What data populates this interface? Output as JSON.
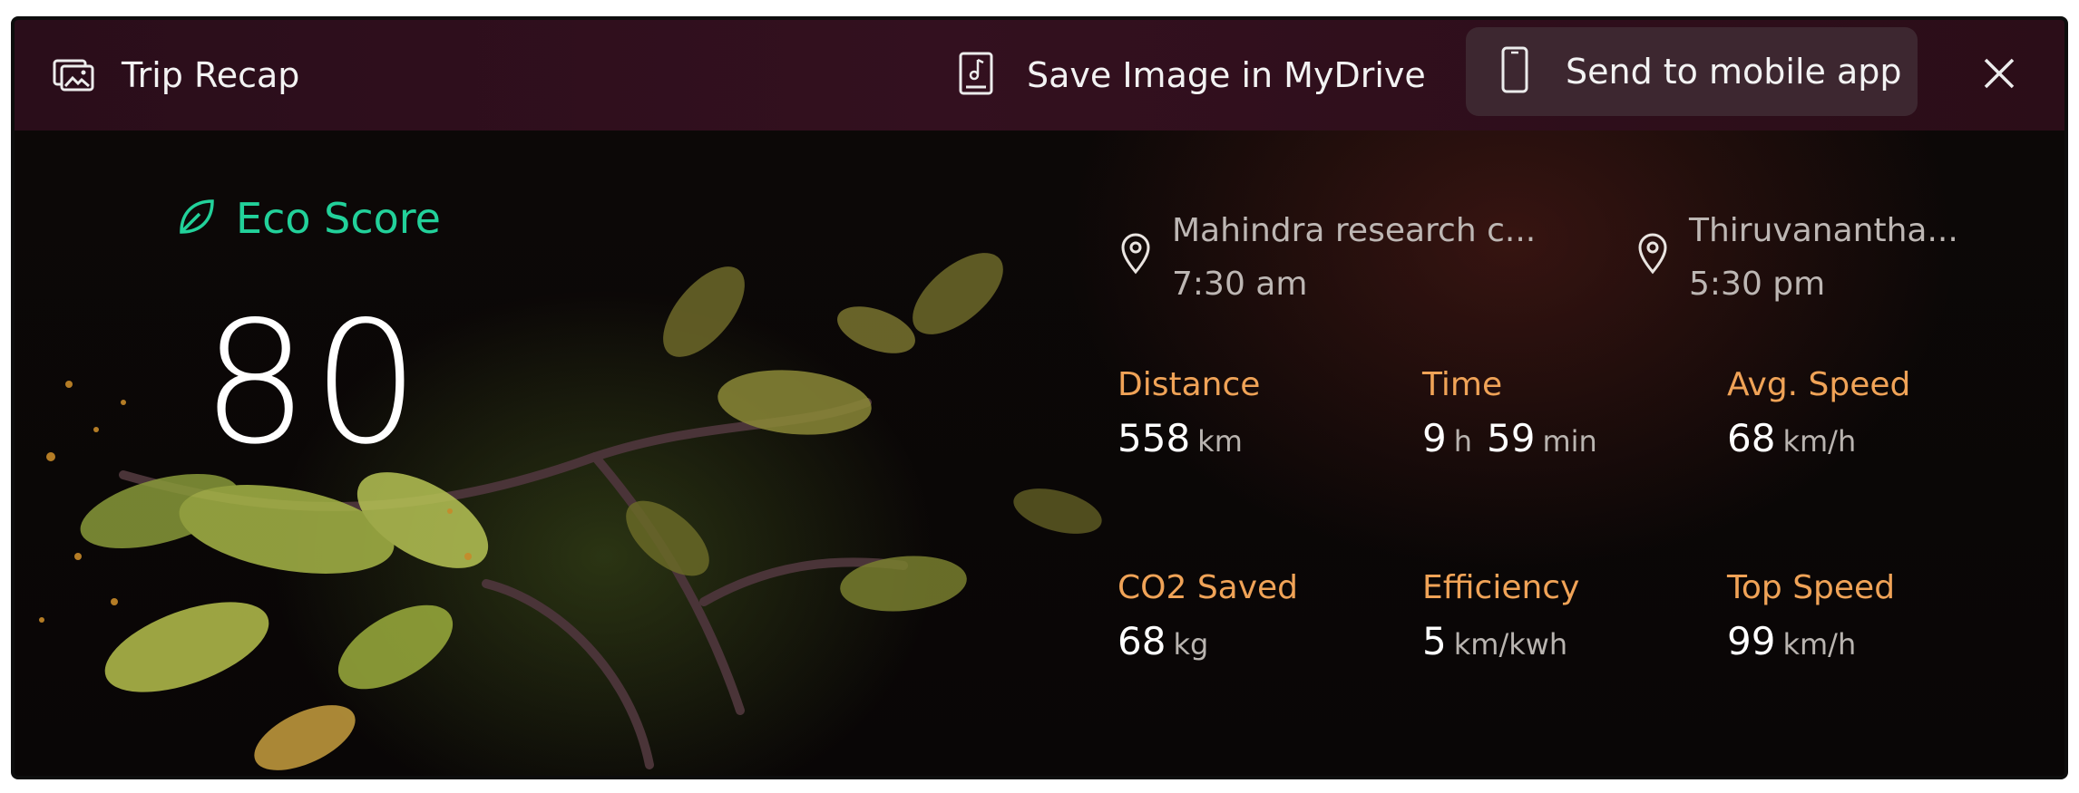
{
  "header": {
    "title": "Trip Recap",
    "save_label": "Save Image in MyDrive",
    "send_label": "Send to mobile app"
  },
  "eco": {
    "label": "Eco Score",
    "score": "80"
  },
  "route": {
    "start": {
      "name": "Mahindra research c...",
      "time": "7:30 am"
    },
    "end": {
      "name": "Thiruvanantha...",
      "time": "5:30 pm"
    }
  },
  "stats": {
    "distance": {
      "label": "Distance",
      "value": "558",
      "unit": "km"
    },
    "time": {
      "label": "Time",
      "hours": "9",
      "hours_unit": "h",
      "minutes": "59",
      "minutes_unit": "min"
    },
    "avg_speed": {
      "label": "Avg. Speed",
      "value": "68",
      "unit": "km/h"
    },
    "co2_saved": {
      "label": "CO2 Saved",
      "value": "68",
      "unit": "kg"
    },
    "efficiency": {
      "label": "Efficiency",
      "value": "5",
      "unit": "km/kwh"
    },
    "top_speed": {
      "label": "Top Speed",
      "value": "99",
      "unit": "km/h"
    }
  },
  "colors": {
    "header_bg": "#2a0d1a",
    "eco_green": "#22d19a",
    "stat_label_orange": "#f0a357",
    "send_button_bg": "#3d2730"
  },
  "icons": {
    "title": "gallery-icon",
    "save": "save-image-icon",
    "send": "mobile-phone-icon",
    "close": "close-icon",
    "eco": "leaf-icon",
    "location": "location-pin-icon"
  }
}
